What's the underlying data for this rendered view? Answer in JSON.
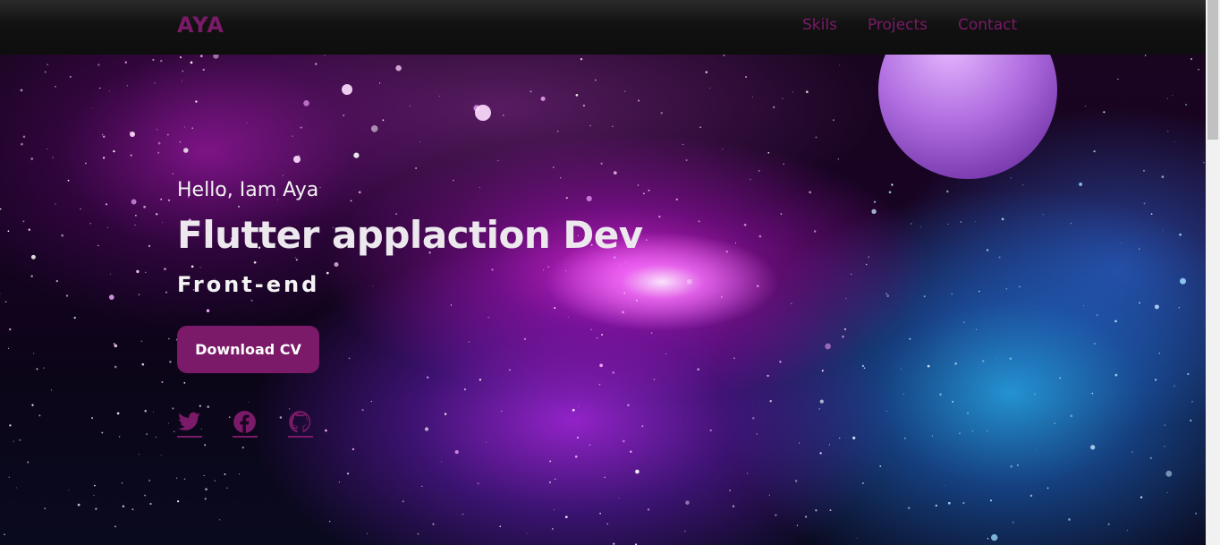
{
  "brand": {
    "logo": "AYA",
    "accent_color": "#7b1a68"
  },
  "nav": {
    "links": [
      {
        "label": "Skils"
      },
      {
        "label": "Projects"
      },
      {
        "label": "Contact"
      }
    ]
  },
  "hero": {
    "greeting": "Hello, Iam Aya",
    "headline": "Flutter applaction Dev",
    "role": "Front-end",
    "cta_label": "Download CV",
    "background": "galaxy-space-image"
  },
  "socials": [
    {
      "icon": "twitter-icon"
    },
    {
      "icon": "facebook-icon"
    },
    {
      "icon": "github-icon"
    }
  ]
}
